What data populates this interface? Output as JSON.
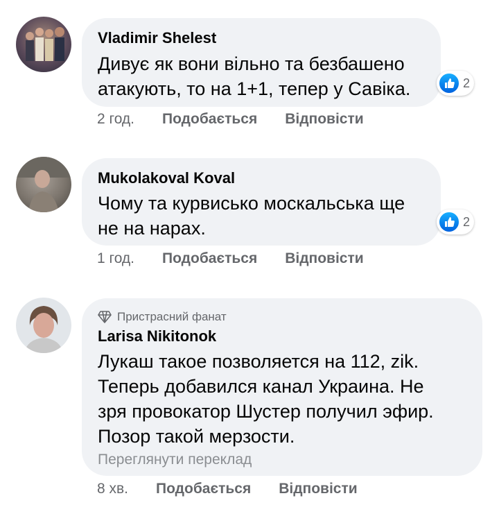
{
  "comments": [
    {
      "author": "Vladimir Shelest",
      "text_lines": [
        "Дивує як вони вільно та безбашено",
        "атакують, то на 1+1, тепер у Савіка."
      ],
      "reaction_count": "2",
      "time": "2 год.",
      "like_label": "Подобається",
      "reply_label": "Відповісти"
    },
    {
      "author": "Mukolakoval Koval",
      "text_lines": [
        "Чому та курвисько москальська ще",
        "не на нарах."
      ],
      "reaction_count": "2",
      "time": "1 год.",
      "like_label": "Подобається",
      "reply_label": "Відповісти"
    },
    {
      "badge": "Пристрасний фанат",
      "author": "Larisa Nikitonok",
      "text_lines": [
        "Лукаш такое позволяется на 112, zik.",
        "Теперь добавился канал Украина. Не",
        "зря провокатор Шустер получил эфир.",
        "Позор такой мерзости."
      ],
      "translate_label": "Переглянути переклад",
      "time": "8 хв.",
      "like_label": "Подобається",
      "reply_label": "Відповісти"
    }
  ],
  "colors": {
    "bubble": "#f0f2f5",
    "like_blue": "#0a7cff",
    "meta_gray": "#65676b"
  },
  "icons": [
    "like-icon",
    "diamond-icon"
  ]
}
